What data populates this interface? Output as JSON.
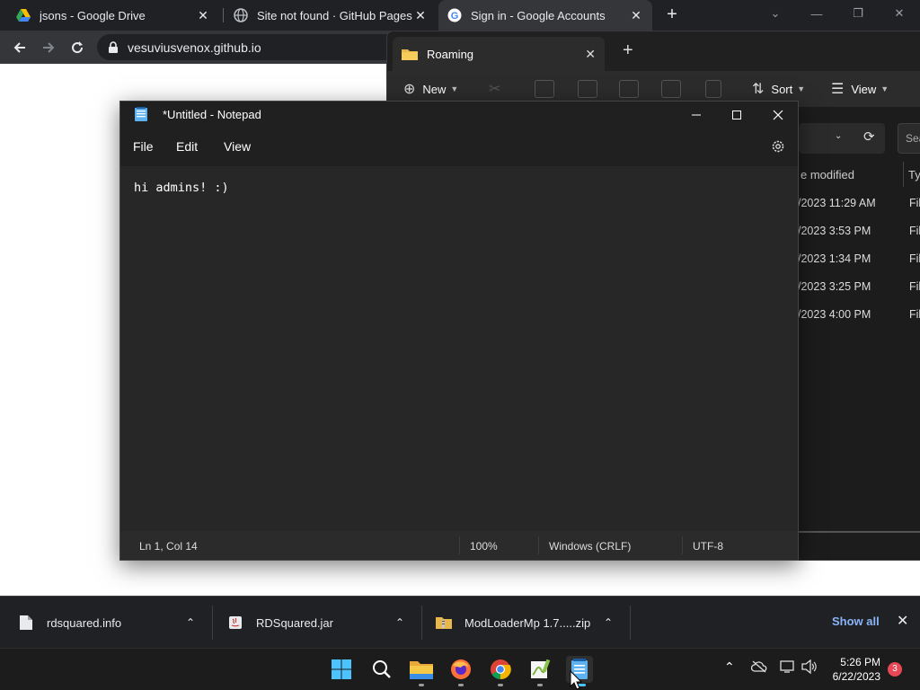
{
  "chrome": {
    "tabs": [
      {
        "title": "jsons - Google Drive",
        "icon": "google-drive-icon",
        "close": "✕"
      },
      {
        "title": "Site not found · GitHub Pages",
        "icon": "globe-icon",
        "close": "✕"
      },
      {
        "title": "Sign in - Google Accounts",
        "icon": "google-icon",
        "close": "✕"
      }
    ],
    "new_tab": "+",
    "url": "vesuviusvenox.github.io",
    "window_controls": {
      "chevron": "⌄",
      "minimize": "—",
      "restore": "❐",
      "close": "✕"
    }
  },
  "explorer": {
    "tab_title": "Roaming",
    "tab_close": "✕",
    "new_tab": "+",
    "toolbar": {
      "new": "New",
      "sort": "Sort",
      "view": "View"
    },
    "search_placeholder": "Sea",
    "columns": {
      "modified": "e modified",
      "type": "Typ"
    },
    "rows": [
      {
        "modified": "/2023 11:29 AM",
        "type": "Fil"
      },
      {
        "modified": "/2023 3:53 PM",
        "type": "Fil"
      },
      {
        "modified": "/2023 1:34 PM",
        "type": "Fil"
      },
      {
        "modified": "/2023 3:25 PM",
        "type": "Fil"
      },
      {
        "modified": "/2023 4:00 PM",
        "type": "Fil"
      }
    ]
  },
  "notepad": {
    "title": "*Untitled - Notepad",
    "menu": {
      "file": "File",
      "edit": "Edit",
      "view": "View"
    },
    "content": "hi admins! :)",
    "status": {
      "position": "Ln 1, Col 14",
      "zoom": "100%",
      "line_ending": "Windows (CRLF)",
      "encoding": "UTF-8"
    }
  },
  "downloads": {
    "items": [
      {
        "name": "rdsquared.info",
        "icon": "file-icon"
      },
      {
        "name": "RDSquared.jar",
        "icon": "java-jar-icon"
      },
      {
        "name": "ModLoaderMp 1.7.....zip",
        "icon": "zip-archive-icon"
      }
    ],
    "show_all": "Show all",
    "close": "✕"
  },
  "taskbar": {
    "apps": [
      "start-icon",
      "search-icon",
      "file-explorer-icon",
      "firefox-icon",
      "chrome-icon",
      "notepad-plus-plus-icon",
      "notepad-icon"
    ],
    "time": "5:26 PM",
    "date": "6/22/2023",
    "notification_count": "3"
  },
  "colors": {
    "accent": "#0078d4",
    "chrome_dark": "#202124",
    "link": "#8ab4f8",
    "badge": "#e74856"
  }
}
